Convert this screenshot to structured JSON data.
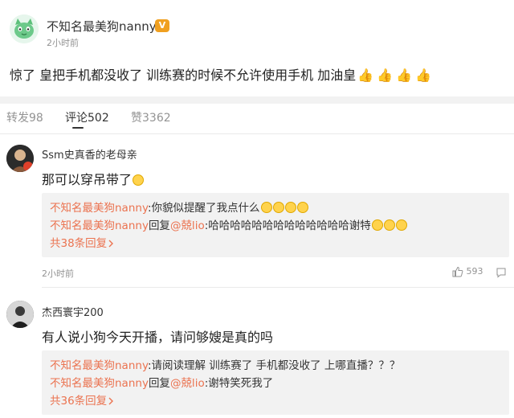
{
  "post": {
    "username": "不知名最美狗nanny",
    "time": "2小时前",
    "text": "惊了 皇把手机都没收了 训练赛的时候不允许使用手机 加油皇",
    "emoji": "👍👍👍👍"
  },
  "tabs": [
    {
      "label": "转发98"
    },
    {
      "label": "评论502"
    },
    {
      "label": "赞3362"
    }
  ],
  "comments": [
    {
      "username": "Ssm史真香的老母亲",
      "text": "那可以穿吊带了",
      "replies": [
        {
          "user": "不知名最美狗nanny",
          "text": ":你貌似提醒了我点什么"
        },
        {
          "user": "不知名最美狗nanny",
          "mid": "回复",
          "target": "@兢lio",
          "text": ":哈哈哈哈哈哈哈哈哈哈哈哈哈谢特"
        }
      ],
      "more": "共38条回复",
      "time": "2小时前",
      "likes": "593"
    },
    {
      "username": "杰西寰宇200",
      "text": "有人说小狗今天开播，请问够嫂是真的吗",
      "replies": [
        {
          "user": "不知名最美狗nanny",
          "text": ":请阅读理解 训练赛了 手机都没收了 上哪直播？？？"
        },
        {
          "user": "不知名最美狗nanny",
          "mid": "回复",
          "target": "@兢lio",
          "text": ":谢特笑死我了"
        }
      ],
      "more": "共36条回复"
    }
  ]
}
